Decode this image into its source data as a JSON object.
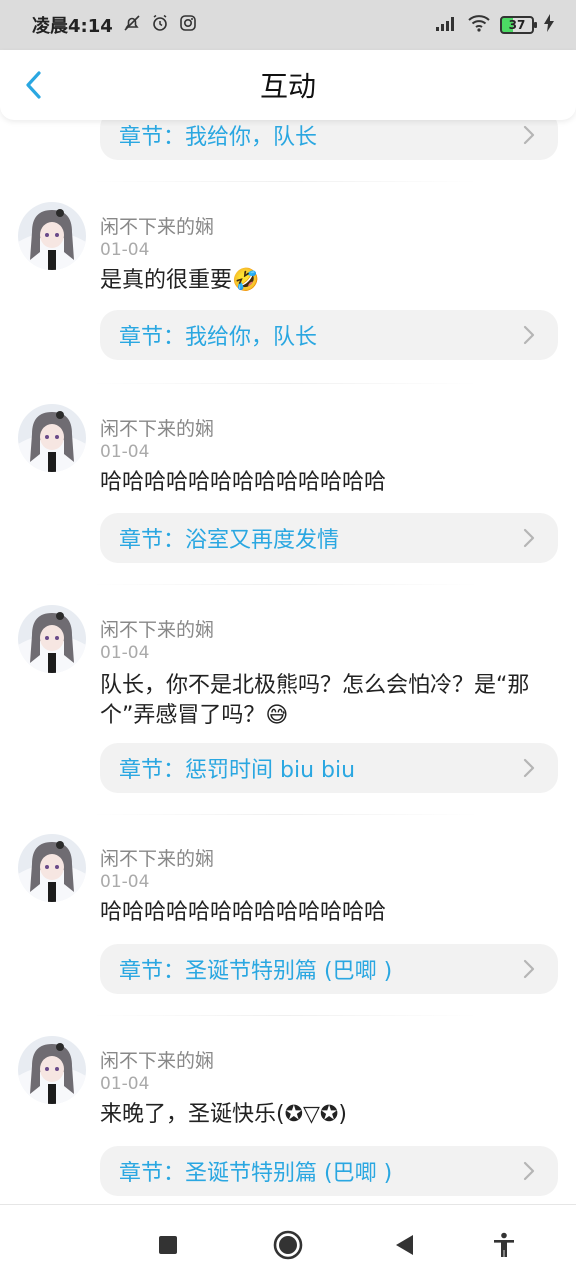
{
  "status_bar": {
    "time": "凌晨4:14",
    "left_icons": [
      "bell-off-icon",
      "alarm-icon",
      "instagram-icon"
    ],
    "battery_level": "37"
  },
  "header": {
    "title": "互动"
  },
  "top_partial_chapter": "章节：我给你，队长",
  "comments": [
    {
      "username": "闲不下来的娴",
      "date": "01-04",
      "text": "是真的很重要🤣",
      "chapter": "章节：我给你，队长"
    },
    {
      "username": "闲不下来的娴",
      "date": "01-04",
      "text": "哈哈哈哈哈哈哈哈哈哈哈哈哈",
      "chapter": "章节：浴室又再度发情"
    },
    {
      "username": "闲不下来的娴",
      "date": "01-04",
      "text": "队长，你不是北极熊吗？怎么会怕冷？是“那个”弄感冒了吗？😅",
      "chapter": "章节：惩罚时间 biu biu"
    },
    {
      "username": "闲不下来的娴",
      "date": "01-04",
      "text": "哈哈哈哈哈哈哈哈哈哈哈哈哈",
      "chapter": "章节：圣诞节特别篇 (巴唧 )"
    },
    {
      "username": "闲不下来的娴",
      "date": "01-04",
      "text": "来晚了，圣诞快乐(✪▽✪)",
      "chapter": "章节：圣诞节特别篇 (巴唧 )"
    }
  ],
  "nav_bar": {
    "buttons": [
      "recents-square-icon",
      "home-circle-icon",
      "back-triangle-icon",
      "accessibility-icon"
    ]
  },
  "colors": {
    "accent": "#2aa7e1",
    "status_bar_bg": "#dcdcdc",
    "pill_bg": "#f2f2f2"
  }
}
